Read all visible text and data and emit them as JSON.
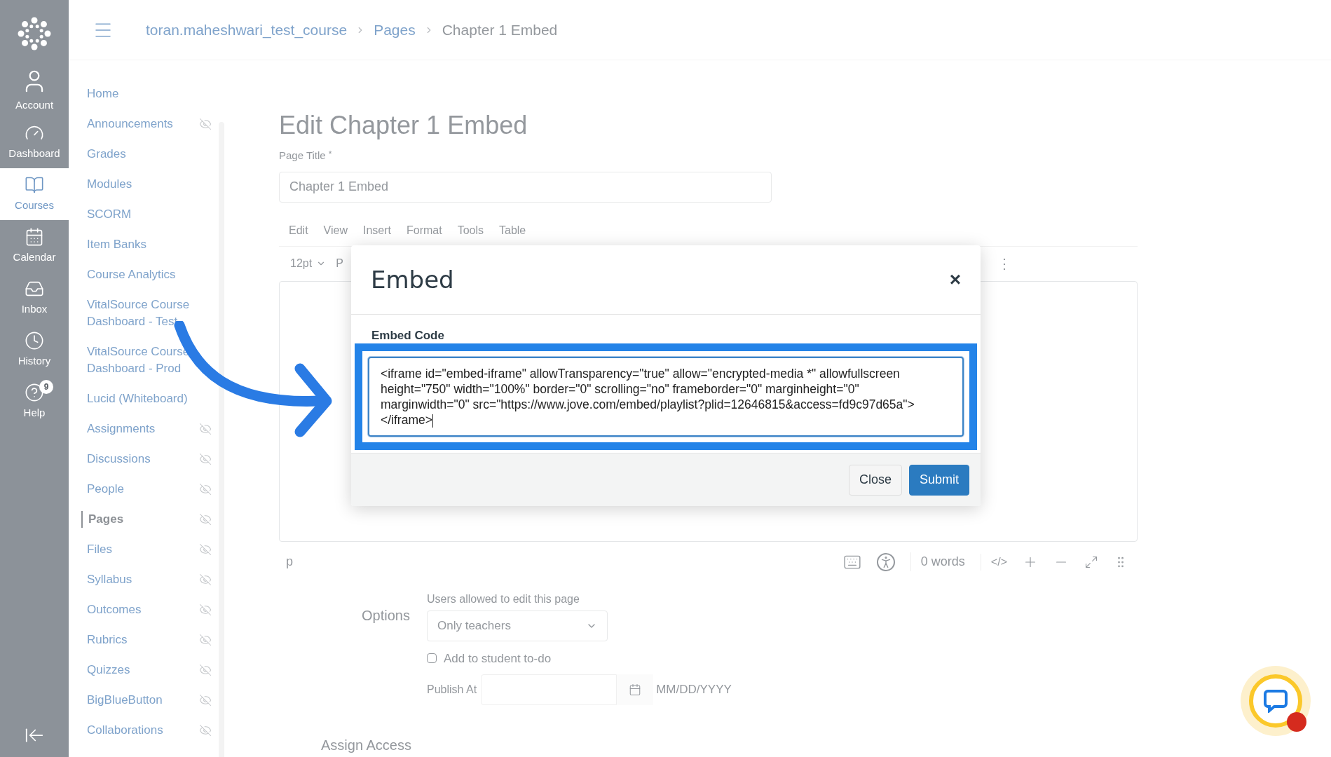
{
  "global_nav": {
    "items": [
      {
        "label": "Account",
        "selected": false
      },
      {
        "label": "Dashboard",
        "selected": false
      },
      {
        "label": "Courses",
        "selected": true
      },
      {
        "label": "Calendar",
        "selected": false
      },
      {
        "label": "Inbox",
        "selected": false
      },
      {
        "label": "History",
        "selected": false
      },
      {
        "label": "Help",
        "selected": false,
        "badge": "9"
      }
    ]
  },
  "breadcrumb": [
    "toran.maheshwari_test_course",
    "Pages",
    "Chapter 1 Embed"
  ],
  "course_nav": {
    "items": [
      {
        "label": "Home",
        "hidden": false,
        "selected": false
      },
      {
        "label": "Announcements",
        "hidden": true,
        "selected": false
      },
      {
        "label": "Grades",
        "hidden": false,
        "selected": false
      },
      {
        "label": "Modules",
        "hidden": false,
        "selected": false
      },
      {
        "label": "SCORM",
        "hidden": false,
        "selected": false
      },
      {
        "label": "Item Banks",
        "hidden": false,
        "selected": false
      },
      {
        "label": "Course Analytics",
        "hidden": false,
        "selected": false
      },
      {
        "label": "VitalSource Course Dashboard - Test",
        "hidden": false,
        "selected": false
      },
      {
        "label": "VitalSource Course Dashboard - Prod",
        "hidden": false,
        "selected": false
      },
      {
        "label": "Lucid (Whiteboard)",
        "hidden": false,
        "selected": false
      },
      {
        "label": "Assignments",
        "hidden": true,
        "selected": false
      },
      {
        "label": "Discussions",
        "hidden": true,
        "selected": false
      },
      {
        "label": "People",
        "hidden": true,
        "selected": false
      },
      {
        "label": "Pages",
        "hidden": true,
        "selected": true
      },
      {
        "label": "Files",
        "hidden": true,
        "selected": false
      },
      {
        "label": "Syllabus",
        "hidden": true,
        "selected": false
      },
      {
        "label": "Outcomes",
        "hidden": true,
        "selected": false
      },
      {
        "label": "Rubrics",
        "hidden": true,
        "selected": false
      },
      {
        "label": "Quizzes",
        "hidden": true,
        "selected": false
      },
      {
        "label": "BigBlueButton",
        "hidden": true,
        "selected": false
      },
      {
        "label": "Collaborations",
        "hidden": true,
        "selected": false
      }
    ]
  },
  "editor": {
    "heading": "Edit Chapter 1 Embed",
    "title_label": "Page Title",
    "required_mark": "*",
    "title_value": "Chapter 1 Embed",
    "menu": [
      "Edit",
      "View",
      "Insert",
      "Format",
      "Tools",
      "Table"
    ],
    "font_size": "12pt",
    "block_format": "P",
    "more_symbol": "⋮",
    "status": {
      "element": "p",
      "word_count": "0 words",
      "code_view": "</>"
    }
  },
  "options": {
    "label": "Options",
    "edit_label": "Users allowed to edit this page",
    "edit_value": "Only teachers",
    "todo": {
      "label": "Add to student to-do",
      "checked": false
    },
    "publish_label": "Publish At",
    "date_format": "MM/DD/YYYY",
    "assign_access": "Assign Access"
  },
  "modal": {
    "title": "Embed",
    "close_symbol": "×",
    "field_label": "Embed Code",
    "code": "<iframe id=\"embed-iframe\" allowTransparency=\"true\" allow=\"encrypted-media *\" allowfullscreen height=\"750\" width=\"100%\" border=\"0\" scrolling=\"no\" frameborder=\"0\" marginheight=\"0\" marginwidth=\"0\" src=\"https://www.jove.com/embed/playlist?plid=12646815&access=fd9c97d65a\"></iframe>",
    "buttons": [
      {
        "label": "Close",
        "kind": "secondary"
      },
      {
        "label": "Submit",
        "kind": "primary"
      }
    ]
  }
}
